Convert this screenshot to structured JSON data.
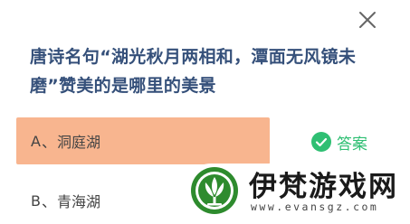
{
  "quiz": {
    "question": "唐诗名句“湖光秋月两相和，潭面无风镜未磨”赞美的是哪里的美景",
    "options": [
      {
        "letter": "A",
        "separator": "、",
        "text": "洞庭湖",
        "state": "correct"
      },
      {
        "letter": "B",
        "separator": "、",
        "text": "青海湖",
        "state": "normal"
      }
    ],
    "answer_tag": "答案",
    "close_icon": "close-icon",
    "check_icon": "check-circle-icon"
  },
  "watermark": {
    "title": "伊梵游戏网",
    "url": "www.evansgz.com",
    "logo_icon": "lotus-logo-icon"
  },
  "colors": {
    "question_text": "#35507a",
    "option_highlight": "#f8b58f",
    "option_text": "#444444",
    "answer_green": "#2fbf73",
    "logo_green": "#2e8b2e"
  }
}
